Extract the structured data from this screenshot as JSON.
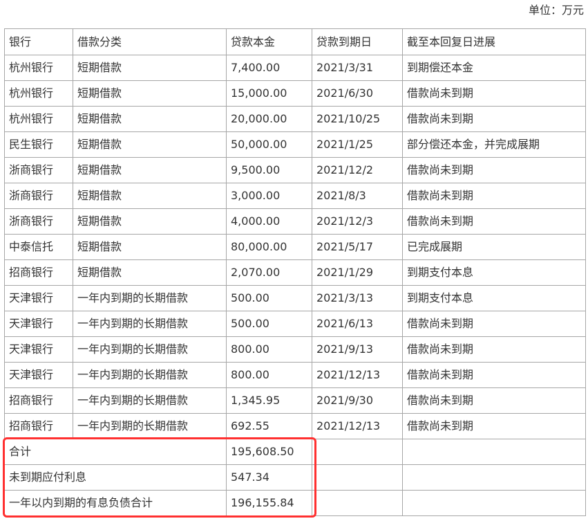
{
  "unit_label": "单位：万元",
  "columns": [
    "银行",
    "借款分类",
    "贷款本金",
    "贷款到期日",
    "截至本回复日进展"
  ],
  "rows": [
    [
      "杭州银行",
      "短期借款",
      "7,400.00",
      "2021/3/31",
      "到期偿还本金"
    ],
    [
      "杭州银行",
      "短期借款",
      "15,000.00",
      "2021/6/30",
      "借款尚未到期"
    ],
    [
      "杭州银行",
      "短期借款",
      "20,000.00",
      "2021/10/25",
      "借款尚未到期"
    ],
    [
      "民生银行",
      "短期借款",
      "50,000.00",
      "2021/1/25",
      "部分偿还本金，并完成展期"
    ],
    [
      "浙商银行",
      "短期借款",
      "9,500.00",
      "2021/12/2",
      "借款尚未到期"
    ],
    [
      "浙商银行",
      "短期借款",
      "3,000.00",
      "2021/8/3",
      "借款尚未到期"
    ],
    [
      "浙商银行",
      "短期借款",
      "4,000.00",
      "2021/12/3",
      "借款尚未到期"
    ],
    [
      "中泰信托",
      "短期借款",
      "80,000.00",
      "2021/5/17",
      "已完成展期"
    ],
    [
      "招商银行",
      "短期借款",
      "2,070.00",
      "2021/1/29",
      "到期支付本息"
    ],
    [
      "天津银行",
      "一年内到期的长期借款",
      "500.00",
      "2021/3/13",
      "到期支付本息"
    ],
    [
      "天津银行",
      "一年内到期的长期借款",
      "500.00",
      "2021/6/13",
      "借款尚未到期"
    ],
    [
      "天津银行",
      "一年内到期的长期借款",
      "800.00",
      "2021/9/13",
      "借款尚未到期"
    ],
    [
      "天津银行",
      "一年内到期的长期借款",
      "800.00",
      "2021/12/13",
      "借款尚未到期"
    ],
    [
      "招商银行",
      "一年内到期的长期借款",
      "1,345.95",
      "2021/9/30",
      "借款尚未到期"
    ],
    [
      "招商银行",
      "一年内到期的长期借款",
      "692.55",
      "2021/12/13",
      "借款尚未到期"
    ]
  ],
  "summary": [
    {
      "label": "合计",
      "value": "195,608.50"
    },
    {
      "label": "未到期应付利息",
      "value": "547.34"
    },
    {
      "label": "一年以内到期的有息负债合计",
      "value": "196,155.84"
    }
  ],
  "colors": {
    "border": "#a6a6a6",
    "text": "#333333",
    "highlight": "#ff3030"
  }
}
